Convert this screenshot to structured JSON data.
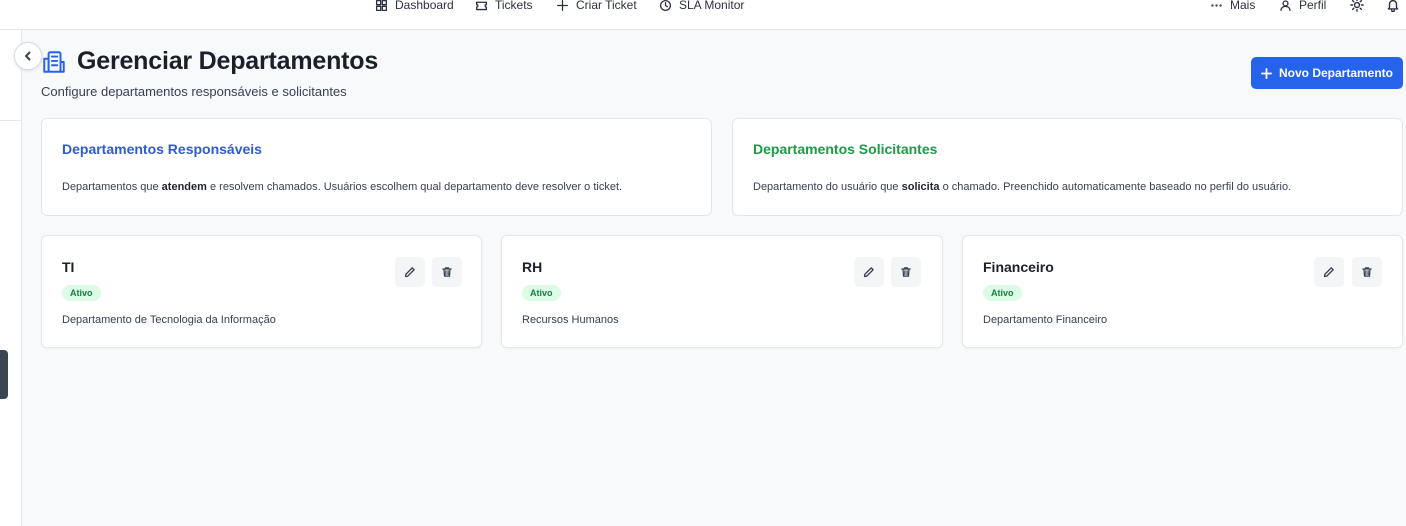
{
  "nav": {
    "items": [
      {
        "label": "Dashboard",
        "icon": "dashboard-icon"
      },
      {
        "label": "Tickets",
        "icon": "ticket-icon"
      },
      {
        "label": "Criar Ticket",
        "icon": "plus-icon"
      },
      {
        "label": "SLA Monitor",
        "icon": "clock-icon"
      }
    ],
    "more_label": "Mais",
    "profile_label": "Perfil",
    "theme_icon": "sun-icon",
    "notifications_icon": "bell-icon"
  },
  "header": {
    "title": "Gerenciar Departamentos",
    "subtitle": "Configure departamentos responsáveis e solicitantes",
    "new_button_label": "Novo Departamento",
    "title_icon": "building-icon"
  },
  "info_cards": {
    "responsible": {
      "title": "Departamentos Responsáveis",
      "desc_before": "Departamentos que ",
      "desc_bold": "atendem",
      "desc_after": " e resolvem chamados. Usuários escolhem qual departamento deve resolver o ticket.",
      "color": "#2f5bd0"
    },
    "requester": {
      "title": "Departamentos Solicitantes",
      "desc_before": "Departamento do usuário que ",
      "desc_bold": "solicita",
      "desc_after": " o chamado. Preenchido automaticamente baseado no perfil do usuário.",
      "color": "#1e9a46"
    }
  },
  "departments": [
    {
      "name": "TI",
      "status": "Ativo",
      "description": "Departamento de Tecnologia da Informação"
    },
    {
      "name": "RH",
      "status": "Ativo",
      "description": "Recursos Humanos"
    },
    {
      "name": "Financeiro",
      "status": "Ativo",
      "description": "Departamento Financeiro"
    }
  ],
  "colors": {
    "accent": "#2563eb",
    "active_badge_bg": "#dcfce7",
    "active_badge_text": "#15803d"
  }
}
